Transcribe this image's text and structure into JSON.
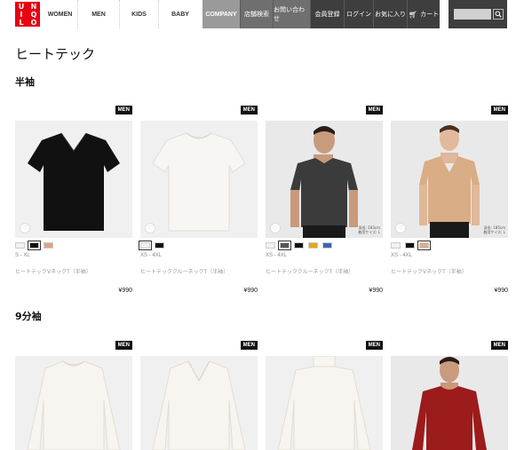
{
  "header": {
    "logo_letters": [
      "U",
      "N",
      "I",
      "Q",
      "L",
      "O"
    ],
    "nav": [
      "WOMEN",
      "MEN",
      "KIDS",
      "BABY"
    ],
    "company": "COMPANY",
    "links": [
      "店舗検索",
      "お問い合わせ",
      "会員登録",
      "ログイン",
      "お気に入り"
    ],
    "cart": "カート"
  },
  "page_title": "ヒートテック",
  "sections": [
    {
      "title": "半袖",
      "products": [
        {
          "badge": "MEN",
          "sizes": "S - XL",
          "name": "ヒートテックVネックT（半袖）",
          "price": "¥990",
          "swatches": [
            "#f2f2f2",
            "#111111",
            "#d9a788"
          ],
          "selected": 1,
          "image": "black-vneck"
        },
        {
          "badge": "MEN",
          "sizes": "XS - 4XL",
          "name": "ヒートテッククルーネックT（半袖）",
          "price": "¥990",
          "swatches": [
            "#f4f2ee",
            "#111111"
          ],
          "selected": 0,
          "image": "white-crew"
        },
        {
          "badge": "MEN",
          "sizes": "XS - 4XL",
          "name": "ヒートテッククルーネックT（半袖）",
          "price": "¥990",
          "swatches": [
            "#f4f2ee",
            "#555555",
            "#111111",
            "#e5a51b",
            "#3f62b0"
          ],
          "selected": 1,
          "image": "model-grey",
          "size_note": [
            "身長: 183cm",
            "着用サイズ: L"
          ]
        },
        {
          "badge": "MEN",
          "sizes": "XS - 4XL",
          "name": "ヒートテックVネックT（半袖）",
          "price": "¥990",
          "swatches": [
            "#f4f2ee",
            "#111111",
            "#d9b08c"
          ],
          "selected": 2,
          "image": "model-beige",
          "size_note": [
            "身長: 185cm",
            "着用サイズ: L"
          ]
        }
      ]
    },
    {
      "title": "9分袖",
      "products": [
        {
          "badge": "MEN",
          "image": "white-long-crew"
        },
        {
          "badge": "MEN",
          "image": "white-long-vneck"
        },
        {
          "badge": "MEN",
          "image": "white-turtle"
        },
        {
          "badge": "MEN",
          "image": "model-red"
        }
      ]
    }
  ],
  "colors": {
    "accent": "#e60012",
    "dark_nav": "#3e3e3e",
    "company_bg": "#9a9a9a"
  }
}
